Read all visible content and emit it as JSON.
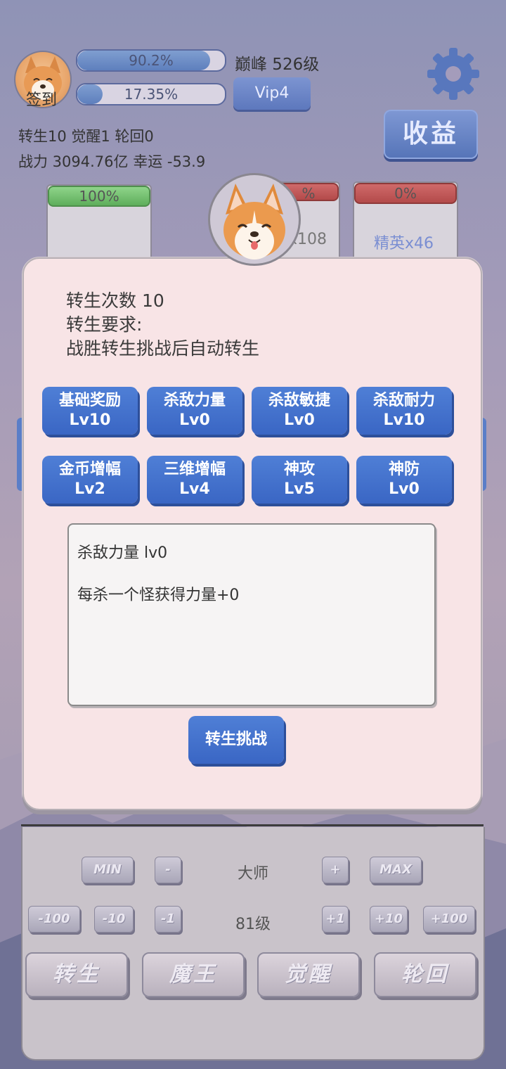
{
  "header": {
    "checkin_label": "签到",
    "exp_bar": {
      "percent_text": "90.2%",
      "fill": 0.902
    },
    "peak_text": "巅峰 526级",
    "second_bar": {
      "percent_text": "17.35%",
      "fill": 0.1735
    },
    "vip_label": "Vip4",
    "income_label": "收益",
    "stats_line1": "转生10 觉醒1 轮回0",
    "stats_line2": "战力 3094.76亿  幸运 -53.9"
  },
  "cards": [
    {
      "bar_text": "100%",
      "bar_color": "green",
      "label": ""
    },
    {
      "bar_text": "%",
      "bar_color": "red",
      "label": "x108"
    },
    {
      "bar_text": "0%",
      "bar_color": "red",
      "label": "精英x46"
    }
  ],
  "modal": {
    "rebirth_count": "转生次数 10",
    "requirement_title": "转生要求:",
    "requirement_text": "战胜转生挑战后自动转生",
    "skills": [
      {
        "name": "基础奖励",
        "level": "Lv10"
      },
      {
        "name": "杀敌力量",
        "level": "Lv0"
      },
      {
        "name": "杀敌敏捷",
        "level": "Lv0"
      },
      {
        "name": "杀敌耐力",
        "level": "Lv10"
      },
      {
        "name": "金币增幅",
        "level": "Lv2"
      },
      {
        "name": "三维增幅",
        "level": "Lv4"
      },
      {
        "name": "神攻",
        "level": "Lv5"
      },
      {
        "name": "神防",
        "level": "Lv0"
      }
    ],
    "desc_title": "杀敌力量 lv0",
    "desc_body": "每杀一个怪获得力量+0",
    "challenge_label": "转生挑战"
  },
  "panel": {
    "row1": {
      "min": "MIN",
      "minus": "-",
      "center": "大师",
      "plus": "+",
      "max": "MAX"
    },
    "row2": {
      "m100": "-100",
      "m10": "-10",
      "m1": "-1",
      "center": "81级",
      "p1": "+1",
      "p10": "+10",
      "p100": "+100"
    },
    "tabs": [
      "转生",
      "魔王",
      "觉醒",
      "轮回"
    ]
  },
  "colors": {
    "accent": "#3a66c4",
    "modal_bg": "#f8e4e6",
    "green": "#5eae5b",
    "red": "#b34a4a"
  }
}
